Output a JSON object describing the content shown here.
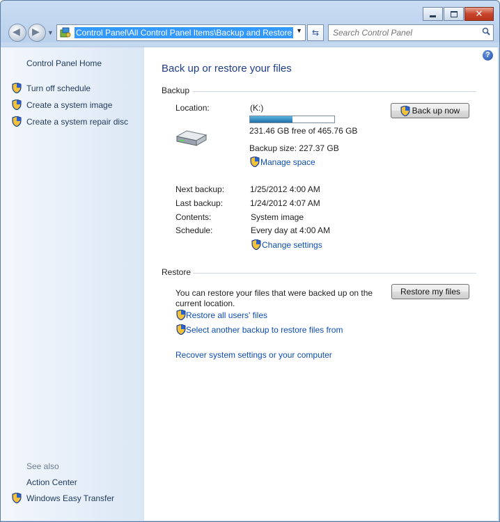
{
  "window": {
    "close_glyph": "✕"
  },
  "nav": {
    "address": "Control Panel\\All Control Panel Items\\Backup and Restore",
    "search_placeholder": "Search Control Panel"
  },
  "sidebar": {
    "home": "Control Panel Home",
    "items": [
      {
        "label": "Turn off schedule",
        "icon": "uac-shield-icon"
      },
      {
        "label": "Create a system image",
        "icon": "uac-shield-icon"
      },
      {
        "label": "Create a system repair disc",
        "icon": "uac-shield-icon"
      }
    ],
    "see_also": "See also",
    "see_also_items": [
      {
        "label": "Action Center"
      },
      {
        "label": "Windows Easy Transfer",
        "icon": "uac-shield-icon"
      }
    ]
  },
  "main": {
    "title": "Back up or restore your files",
    "backup": {
      "heading": "Backup",
      "location_label": "Location:",
      "location_value": "(K:)",
      "drive_used_fraction": 0.503,
      "free_text": "231.46 GB free of 465.76 GB",
      "backup_size": "Backup size: 227.37 GB",
      "manage_space": "Manage space",
      "back_up_now": "Back up now",
      "next_backup_label": "Next backup:",
      "next_backup_value": "1/25/2012 4:00 AM",
      "last_backup_label": "Last backup:",
      "last_backup_value": "1/24/2012 4:07 AM",
      "contents_label": "Contents:",
      "contents_value": "System image",
      "schedule_label": "Schedule:",
      "schedule_value": "Every day at 4:00 AM",
      "change_settings": "Change settings"
    },
    "restore": {
      "heading": "Restore",
      "description_line1": "You can restore your files that were backed up on the",
      "description_line2": "current location.",
      "restore_my_files": "Restore my files",
      "restore_all_users": "Restore all users' files",
      "select_another": "Select another backup to restore files from",
      "recover": "Recover system settings or your computer"
    }
  },
  "colors": {
    "accent": "#3399ff",
    "link": "#0c4cb0",
    "title": "#1e3b8a",
    "sidebar_link": "#1e395b"
  }
}
